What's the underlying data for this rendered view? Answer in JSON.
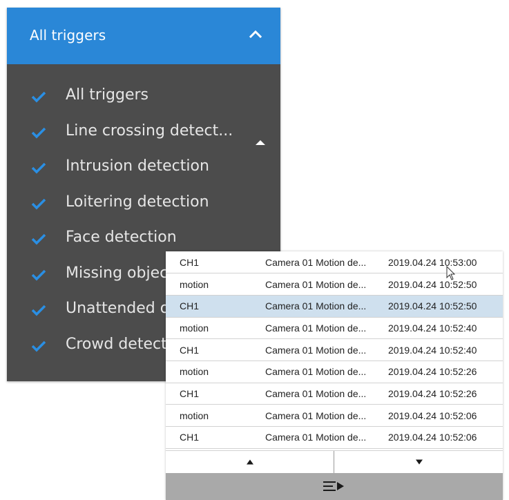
{
  "trigger_filter": {
    "header_label": "All triggers",
    "expanded": true,
    "items": [
      {
        "label": "All triggers",
        "checked": true
      },
      {
        "label": "Line crossing detect...",
        "checked": true
      },
      {
        "label": "Intrusion detection",
        "checked": true
      },
      {
        "label": "Loitering detection",
        "checked": true
      },
      {
        "label": "Face detection",
        "checked": true
      },
      {
        "label": "Missing objec",
        "checked": true
      },
      {
        "label": "Unattended o",
        "checked": true
      },
      {
        "label": "Crowd detect",
        "checked": true
      }
    ]
  },
  "event_log": {
    "rows": [
      {
        "source": "CH1",
        "description": "Camera 01 Motion de...",
        "time": "2019.04.24 10:53:00",
        "selected": false
      },
      {
        "source": "motion",
        "description": "Camera 01 Motion de...",
        "time": "2019.04.24 10:52:50",
        "selected": false
      },
      {
        "source": "CH1",
        "description": "Camera 01 Motion de...",
        "time": "2019.04.24 10:52:50",
        "selected": true
      },
      {
        "source": "motion",
        "description": "Camera 01 Motion de...",
        "time": "2019.04.24 10:52:40",
        "selected": false
      },
      {
        "source": "CH1",
        "description": "Camera 01 Motion de...",
        "time": "2019.04.24 10:52:40",
        "selected": false
      },
      {
        "source": "motion",
        "description": "Camera 01 Motion de...",
        "time": "2019.04.24 10:52:26",
        "selected": false
      },
      {
        "source": "CH1",
        "description": "Camera 01 Motion de...",
        "time": "2019.04.24 10:52:26",
        "selected": false
      },
      {
        "source": "motion",
        "description": "Camera 01 Motion de...",
        "time": "2019.04.24 10:52:06",
        "selected": false
      },
      {
        "source": "CH1",
        "description": "Camera 01 Motion de...",
        "time": "2019.04.24 10:52:06",
        "selected": false
      }
    ],
    "pager": {
      "prev_icon": "triangle-up-icon",
      "next_icon": "triangle-down-icon"
    },
    "footer_icon": "playlist-play-icon"
  },
  "colors": {
    "header_blue": "#2a87d7",
    "panel_gray": "#4c4c4c",
    "check_blue": "#2a8fe4",
    "selected_row": "#cfe0ee",
    "footer_gray": "#a9a9a9"
  }
}
